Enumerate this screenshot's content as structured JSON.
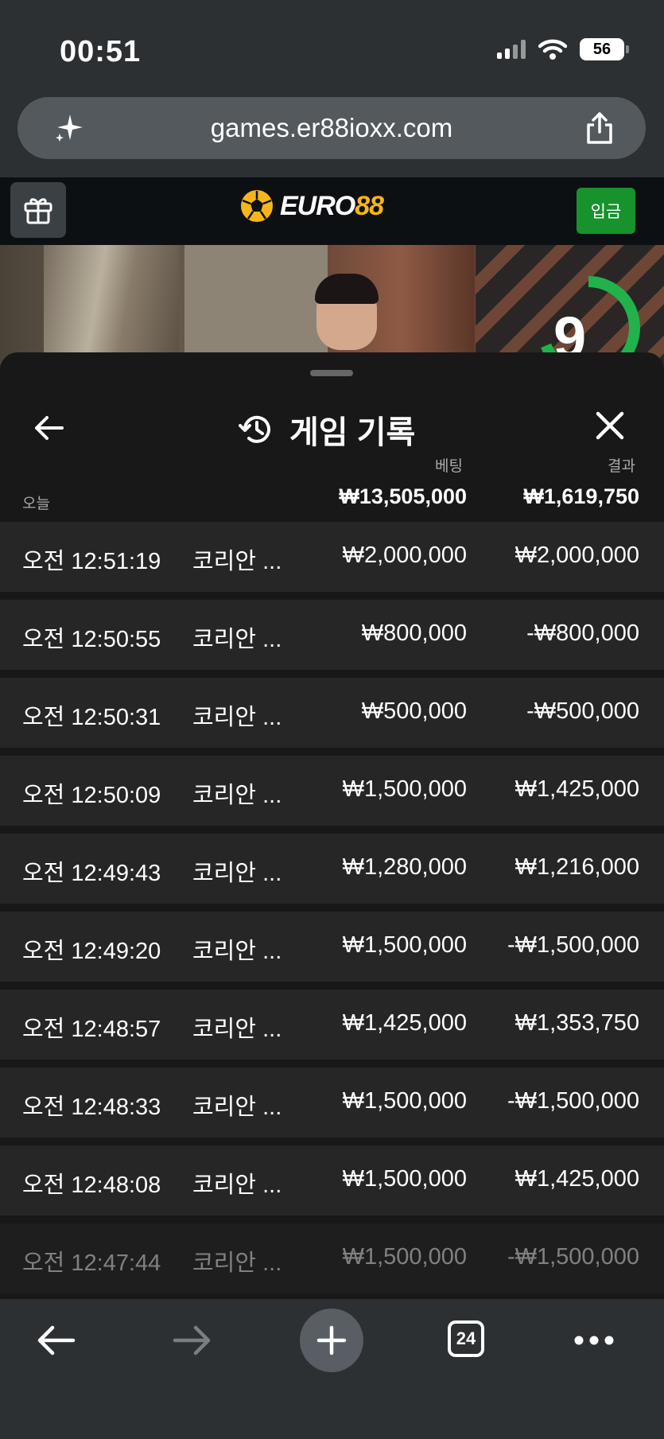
{
  "status": {
    "time": "00:51",
    "battery": "56"
  },
  "browser": {
    "url": "games.er88ioxx.com",
    "tab_count": "24"
  },
  "site": {
    "logo_text_white": "EURO",
    "logo_text_accent": "88",
    "deposit_label": "입금"
  },
  "video": {
    "timer_value": "9"
  },
  "history": {
    "title": "게임 기록",
    "today_label": "오늘",
    "bet_header": "베팅",
    "result_header": "결과",
    "bet_total": "₩13,505,000",
    "result_total": "₩1,619,750",
    "rows": [
      {
        "time": "오전 12:51:19",
        "game": "코리안 ...",
        "bet": "₩2,000,000",
        "result": "₩2,000,000"
      },
      {
        "time": "오전 12:50:55",
        "game": "코리안 ...",
        "bet": "₩800,000",
        "result": "-₩800,000"
      },
      {
        "time": "오전 12:50:31",
        "game": "코리안 ...",
        "bet": "₩500,000",
        "result": "-₩500,000"
      },
      {
        "time": "오전 12:50:09",
        "game": "코리안 ...",
        "bet": "₩1,500,000",
        "result": "₩1,425,000"
      },
      {
        "time": "오전 12:49:43",
        "game": "코리안 ...",
        "bet": "₩1,280,000",
        "result": "₩1,216,000"
      },
      {
        "time": "오전 12:49:20",
        "game": "코리안 ...",
        "bet": "₩1,500,000",
        "result": "-₩1,500,000"
      },
      {
        "time": "오전 12:48:57",
        "game": "코리안 ...",
        "bet": "₩1,425,000",
        "result": "₩1,353,750"
      },
      {
        "time": "오전 12:48:33",
        "game": "코리안 ...",
        "bet": "₩1,500,000",
        "result": "-₩1,500,000"
      },
      {
        "time": "오전 12:48:08",
        "game": "코리안 ...",
        "bet": "₩1,500,000",
        "result": "₩1,425,000"
      },
      {
        "time": "오전 12:47:44",
        "game": "코리안 ...",
        "bet": "₩1,500,000",
        "result": "-₩1,500,000"
      }
    ]
  },
  "colors": {
    "deposit_green": "#17922c",
    "logo_gold": "#f5b51b",
    "timer_green": "#21b24b"
  }
}
